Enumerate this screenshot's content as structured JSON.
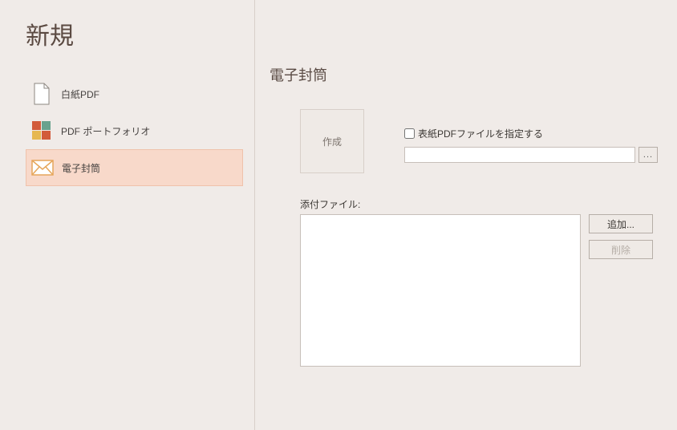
{
  "page_title": "新規",
  "templates": [
    {
      "label": "白紙PDF"
    },
    {
      "label": "PDF ポートフォリオ"
    },
    {
      "label": "電子封筒",
      "selected": true
    }
  ],
  "main": {
    "title": "電子封筒",
    "create_label": "作成",
    "cover_checkbox_label": "表紙PDFファイルを指定する",
    "cover_path": "",
    "browse_label": "...",
    "attach_label": "添付ファイル:",
    "add_label": "追加...",
    "delete_label": "削除"
  }
}
